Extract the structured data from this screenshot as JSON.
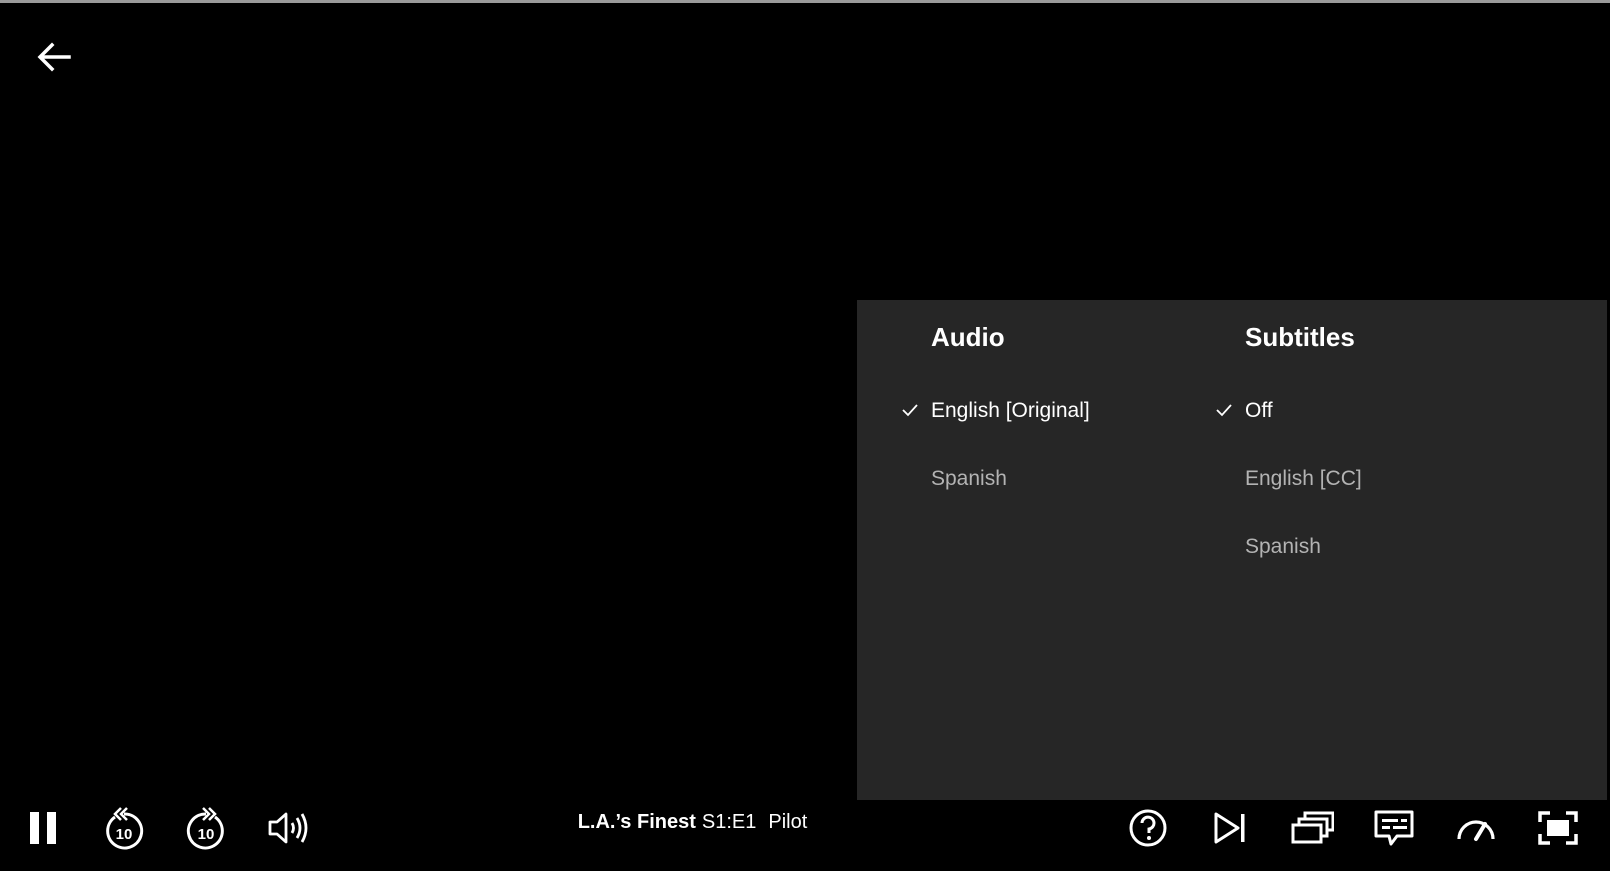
{
  "player": {
    "back_icon": "arrow-left-icon"
  },
  "audio_subtitles_panel": {
    "audio": {
      "title": "Audio",
      "options": [
        {
          "label": "English [Original]",
          "selected": true
        },
        {
          "label": "Spanish",
          "selected": false
        }
      ]
    },
    "subtitles": {
      "title": "Subtitles",
      "options": [
        {
          "label": "Off",
          "selected": true
        },
        {
          "label": "English [CC]",
          "selected": false
        },
        {
          "label": "Spanish",
          "selected": false
        }
      ]
    },
    "check_icon": "checkmark-icon"
  },
  "controls": {
    "episode": {
      "show": "L.A.’s Finest",
      "episode_code": "S1:E1",
      "episode_name": "Pilot"
    },
    "left_icons": [
      "pause-icon",
      "rewind-10-icon",
      "forward-10-icon",
      "volume-icon"
    ],
    "right_icons": [
      "help-icon",
      "next-episode-icon",
      "episodes-icon",
      "subtitles-icon",
      "playback-speed-icon",
      "fullscreen-icon"
    ],
    "rewind_seconds": "10",
    "forward_seconds": "10"
  },
  "colors": {
    "background": "#000000",
    "panel": "#262626",
    "selected_text": "#ffffff",
    "unselected_text": "#b3b3b3"
  }
}
